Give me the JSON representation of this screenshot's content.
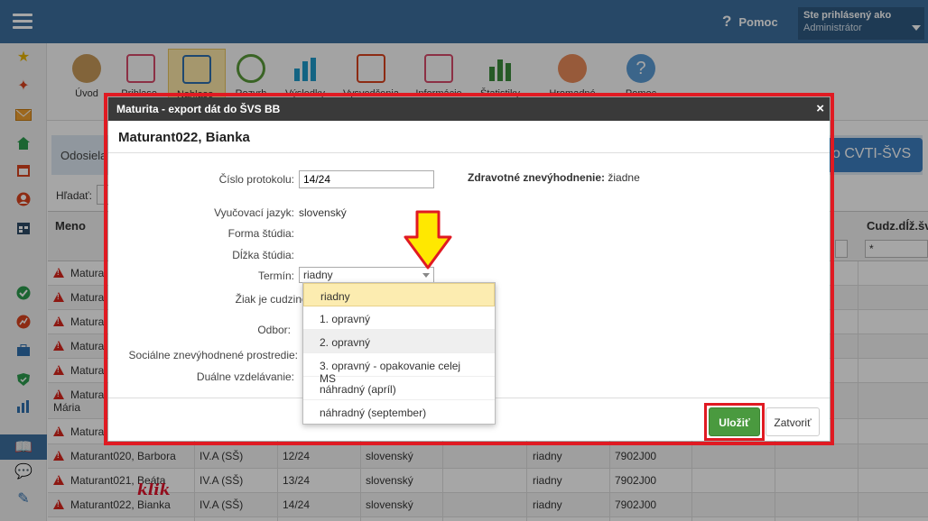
{
  "topbar": {
    "help_label": "Pomoc",
    "user_line1": "Ste prihlásený ako",
    "user_line2": "Administrátor"
  },
  "toolbar": {
    "items": [
      {
        "label": "Úvod",
        "icon": "students-icon"
      },
      {
        "label": "Prihlaso-",
        "icon": "form-icon"
      },
      {
        "label": "Nahlaso-",
        "icon": "export-icon"
      },
      {
        "label": "Rozvrh",
        "icon": "clock-icon"
      },
      {
        "label": "Výsledky",
        "icon": "bar-chart-icon"
      },
      {
        "label": "Vysvedčenia",
        "icon": "certificate-icon"
      },
      {
        "label": "Informácie",
        "icon": "document-icon"
      },
      {
        "label": "Štatistiky",
        "icon": "stats-icon"
      },
      {
        "label": "Hromadné",
        "icon": "group-icon"
      },
      {
        "label": "Pomoc",
        "icon": "help-icon"
      }
    ]
  },
  "page": {
    "odosiela_text": "Odosiela",
    "cvti_button": "o CVTI-ŠVS",
    "search_label": "Hľadať:",
    "col_meno": "Meno",
    "col_cudz": "Cudz.dĺž.šv",
    "filter_star": "*",
    "rows": [
      {
        "name": "Matura",
        "class": "",
        "proto": "",
        "lang": "",
        "term": "",
        "code": ""
      },
      {
        "name": "Matura",
        "class": "",
        "proto": "",
        "lang": "",
        "term": "",
        "code": ""
      },
      {
        "name": "Matura",
        "class": "",
        "proto": "",
        "lang": "",
        "term": "",
        "code": ""
      },
      {
        "name": "Matura",
        "class": "",
        "proto": "",
        "lang": "",
        "term": "",
        "code": ""
      },
      {
        "name": "Matura",
        "class": "",
        "proto": "",
        "lang": "",
        "term": "",
        "code": ""
      },
      {
        "name": "Matura",
        "class": "",
        "proto": "",
        "lang": "",
        "term": "",
        "code": ""
      },
      {
        "name": "Matura",
        "class": "",
        "proto": "",
        "lang": "",
        "term": "",
        "code": ""
      },
      {
        "name": "Maturant020, Barbora",
        "class": "IV.A (SŠ)",
        "proto": "12/24",
        "lang": "slovenský",
        "term": "riadny",
        "code": "7902J00"
      },
      {
        "name": "Maturant021, Beáta",
        "class": "IV.A (SŠ)",
        "proto": "13/24",
        "lang": "slovenský",
        "term": "riadny",
        "code": "7902J00"
      },
      {
        "name": "Maturant022, Bianka",
        "class": "IV.A (SŠ)",
        "proto": "14/24",
        "lang": "slovenský",
        "term": "riadny",
        "code": "7902J00"
      }
    ],
    "row6_line2": "Mária",
    "klik_text": "klik"
  },
  "modal": {
    "title": "Maturita - export dát do ŠVS BB",
    "close_glyph": "×",
    "student_name": "Maturant022, Bianka",
    "labels": {
      "cislo": "Číslo protokolu:",
      "jazyk": "Vyučovací jazyk:",
      "forma": "Forma štúdia:",
      "dlzka": "Dĺžka štúdia:",
      "termin": "Termín:",
      "cudzinec": "Žiak je cudzinec:",
      "odbor": "Odbor:",
      "socialne": "Sociálne znevýhodnené prostredie:",
      "dualne": "Duálne vzdelávanie:"
    },
    "values": {
      "cislo": "14/24",
      "jazyk": "slovenský",
      "termin": "riadny"
    },
    "zdrav_label": "Zdravotné znevýhodnenie:",
    "zdrav_value": "žiadne",
    "save_label": "Uložiť",
    "close_label": "Zatvoriť"
  },
  "dropdown": {
    "options": [
      "riadny",
      "1. opravný",
      "2. opravný",
      "3. opravný - opakovanie celej MS",
      "náhradný (apríl)",
      "náhradný (september)"
    ],
    "selected": "riadny",
    "hovered": "2. opravný"
  },
  "colors": {
    "topbar": "#3d6f9e",
    "highlight_red": "#e01a22",
    "save_green": "#4a9a3f",
    "arrow_yellow": "#ffe800"
  }
}
